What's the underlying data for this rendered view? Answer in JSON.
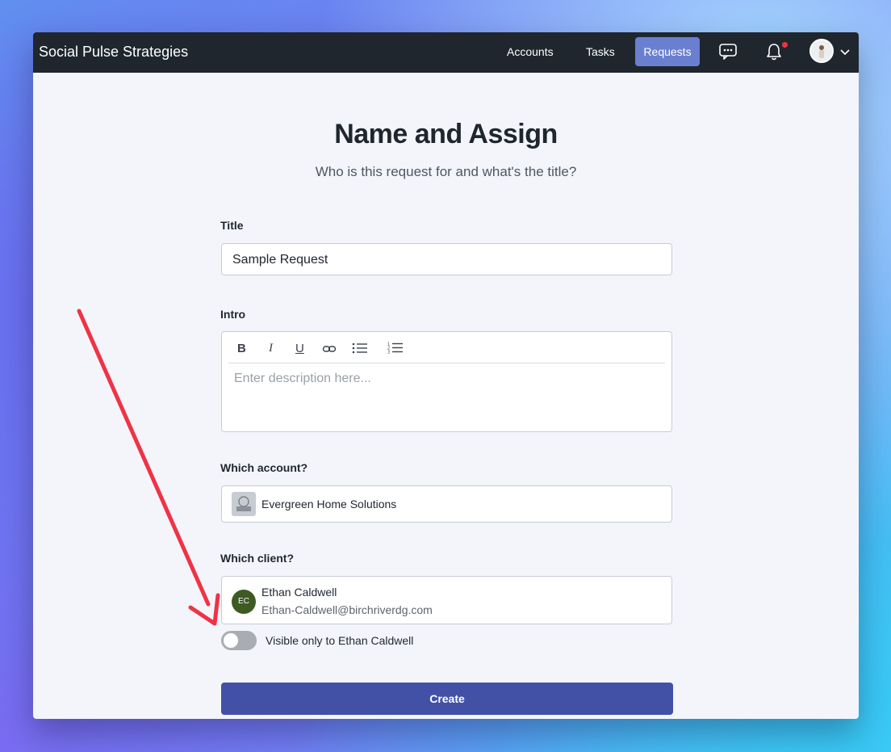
{
  "navbar": {
    "brand": "Social Pulse Strategies",
    "links": [
      "Accounts",
      "Tasks",
      "Requests"
    ],
    "active_link": "Requests",
    "icons": [
      "chat-icon",
      "bell-icon",
      "avatar",
      "chevron-down-icon"
    ],
    "notification_dot_color": "#ef3340"
  },
  "page": {
    "title": "Name and Assign",
    "subtitle": "Who is this request for and what's the title?"
  },
  "form": {
    "title_label": "Title",
    "title_value": "Sample Request",
    "intro_label": "Intro",
    "intro_toolbar": {
      "bold": "B",
      "italic": "I",
      "underline": "U",
      "icons": [
        "link-icon",
        "bullet-list-icon",
        "numbered-list-icon"
      ]
    },
    "intro_placeholder": "Enter description here...",
    "account_label": "Which account?",
    "account_value": "Evergreen Home Solutions",
    "client_label": "Which client?",
    "client_initials": "EC",
    "client_name": "Ethan Caldwell",
    "client_email": "Ethan-Caldwell@birchriverdg.com",
    "visibility_toggle_label": "Visible only to Ethan Caldwell",
    "visibility_toggle_on": false,
    "create_button": "Create"
  },
  "annotation": {
    "arrow_color": "#ef3345"
  },
  "colors": {
    "navbar_bg": "#1f262e",
    "nav_active_bg": "#6b7fd0",
    "primary_button": "#4251a6",
    "client_avatar_bg": "#3e5a23"
  }
}
